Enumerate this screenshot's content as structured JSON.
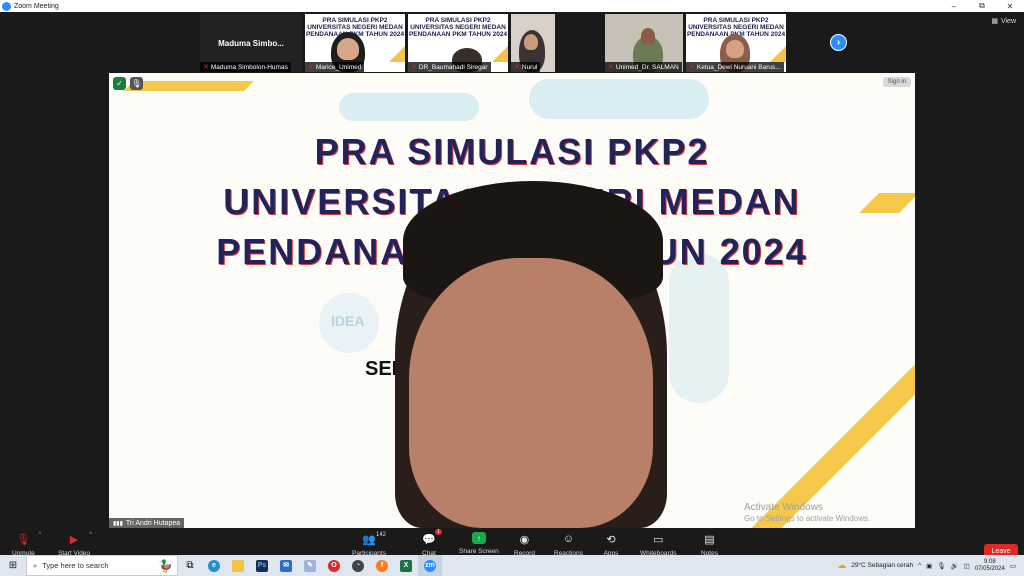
{
  "window": {
    "title": "Zoom Meeting",
    "minimize": "–",
    "maximize": "⧉",
    "close": "✕"
  },
  "view_button": {
    "label": "View"
  },
  "participants": [
    {
      "name": "Maduma Simbolon-Humas",
      "display": "Maduma  Simbo..."
    },
    {
      "name": "Marice_Unimed"
    },
    {
      "name": "DR_Baumahadi Siregar"
    },
    {
      "name": "Nurul"
    },
    {
      "name": "Unimed_Dr. SALMAN"
    },
    {
      "name": "Ketua_Dewi Nuruani Barus..."
    }
  ],
  "slide_thumb": {
    "line1": "PRA SIMULASI PKP2",
    "line2": "UNIVERSITAS NEGERI MEDAN",
    "line3": "PENDANAAN PKM TAHUN 2024"
  },
  "slide": {
    "line1": "PRA SIMULASI PKP2",
    "line2": "UNIVERSITAS NEGERI MEDAN",
    "line3": "PENDANAAN PKM TAHUN 2024",
    "partial": "SEL",
    "idea": "IDEA"
  },
  "main_speaker": {
    "name": "Tri Andri Hutapea"
  },
  "sign_in": "Sign in",
  "watermark": {
    "line1": "Activate Windows",
    "line2": "Go to Settings to activate Windows."
  },
  "toolbar": {
    "unmute": "Unmute",
    "start_video": "Start Video",
    "participants": "Participants",
    "participants_count": "142",
    "chat": "Chat",
    "chat_badge": "1",
    "share_screen": "Share Screen",
    "record": "Record",
    "reactions": "Reactions",
    "apps": "Apps",
    "whiteboards": "Whiteboards",
    "notes": "Notes",
    "leave": "Leave"
  },
  "taskbar": {
    "search_placeholder": "Type here to search",
    "weather": "29°C  Sebagian cerah",
    "time": "9:08",
    "date": "07/05/2024"
  },
  "colors": {
    "zoom_blue": "#2d8cff",
    "leave_red": "#e02828",
    "slide_title": "#23235b",
    "slide_accent": "#f5c84a"
  }
}
